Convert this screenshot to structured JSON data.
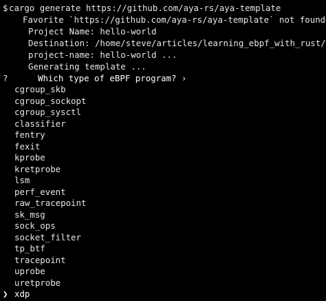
{
  "terminal": {
    "command_prompt": "$",
    "command": "cargo generate https://github.com/aya-rs/aya-template",
    "warning_icon": "warning-icon",
    "warning_text": "Favorite `https://github.com/aya-rs/aya-template` not found in conf",
    "info_lines": [
      {
        "icon": "mage-icon",
        "text": "Project Name: hello-world"
      },
      {
        "icon": "wrench-icon",
        "text": "Destination: /home/steve/articles/learning_ebpf_with_rust/xdp-tuto"
      },
      {
        "icon": "wrench-icon",
        "text": "project-name: hello-world ..."
      },
      {
        "icon": "wrench-icon",
        "text": "Generating template ..."
      }
    ],
    "question_prefix": "?",
    "question_icon": "mage-icon",
    "question_text": "Which type of eBPF program? ›",
    "options": [
      "cgroup_skb",
      "cgroup_sockopt",
      "cgroup_sysctl",
      "classifier",
      "fentry",
      "fexit",
      "kprobe",
      "kretprobe",
      "lsm",
      "perf_event",
      "raw_tracepoint",
      "sk_msg",
      "sock_ops",
      "socket_filter",
      "tp_btf",
      "tracepoint",
      "uprobe",
      "uretprobe",
      "xdp"
    ],
    "selected_option": "xdp",
    "selection_marker": "❯",
    "colors": {
      "background": "#000000",
      "text": "#e6e6e6",
      "question_accent": "#ffffff"
    }
  }
}
